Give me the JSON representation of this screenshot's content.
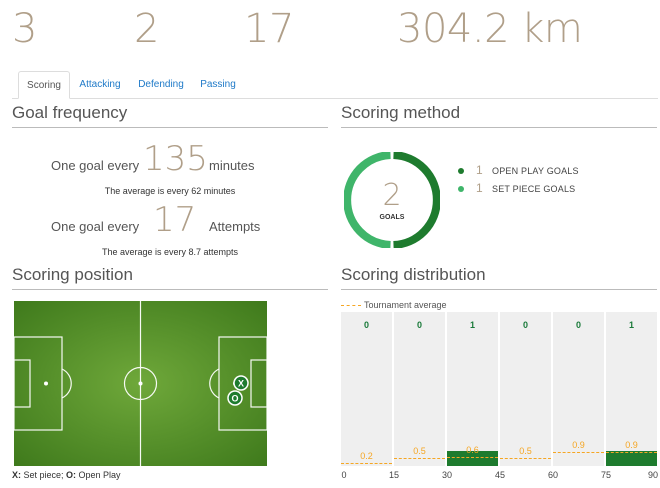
{
  "stats": [
    "3",
    "2",
    "17",
    "304.2 km"
  ],
  "tabs": [
    "Scoring",
    "Attacking",
    "Defending",
    "Passing"
  ],
  "sections": {
    "goal_frequency": "Goal frequency",
    "scoring_method": "Scoring method",
    "scoring_position": "Scoring position",
    "scoring_distribution": "Scoring distribution"
  },
  "goal_frequency": {
    "row1_prefix": "One goal every",
    "row1_value": "135",
    "row1_suffix": "minutes",
    "row1_note": "The average is every 62 minutes",
    "row2_prefix": "One goal every",
    "row2_value": "17",
    "row2_suffix": "Attempts",
    "row2_note": "The average is every 8.7 attempts"
  },
  "scoring_method": {
    "total": "2",
    "total_label": "GOALS",
    "items": [
      {
        "count": "1",
        "label": "OPEN PLAY GOALS",
        "color": "#1e7b2e"
      },
      {
        "count": "1",
        "label": "SET PIECE GOALS",
        "color": "#3fb56a"
      }
    ]
  },
  "scoring_position": {
    "caption_set_key": "X:",
    "caption_set": " Set piece; ",
    "caption_open_key": "O:",
    "caption_open": " Open Play",
    "markers": [
      {
        "symbol": "X",
        "type": "set piece"
      },
      {
        "symbol": "O",
        "type": "open play"
      }
    ]
  },
  "chart_data": {
    "type": "bar",
    "title": "Scoring distribution",
    "legend": "Tournament average",
    "categories": [
      "0-15",
      "15-30",
      "30-45",
      "45-60",
      "60-75",
      "75-90"
    ],
    "ticks": [
      "0",
      "15",
      "30",
      "45",
      "60",
      "75",
      "90"
    ],
    "series": [
      {
        "name": "",
        "values": [
          0,
          0,
          1,
          0,
          0,
          1
        ]
      },
      {
        "name": "Tournament average",
        "values": [
          0.2,
          0.5,
          0.6,
          0.5,
          0.9,
          0.9
        ]
      }
    ],
    "goal_labels": [
      "0",
      "0",
      "1",
      "0",
      "0",
      "1"
    ],
    "avg_labels": [
      "0.2",
      "0.5",
      "0.6",
      "0.5",
      "0.9",
      "0.9"
    ],
    "ylim": [
      0,
      10
    ],
    "colors": {
      "bar": "#1e7b2e",
      "average": "#f5a623",
      "column_bg": "#efefef"
    }
  }
}
